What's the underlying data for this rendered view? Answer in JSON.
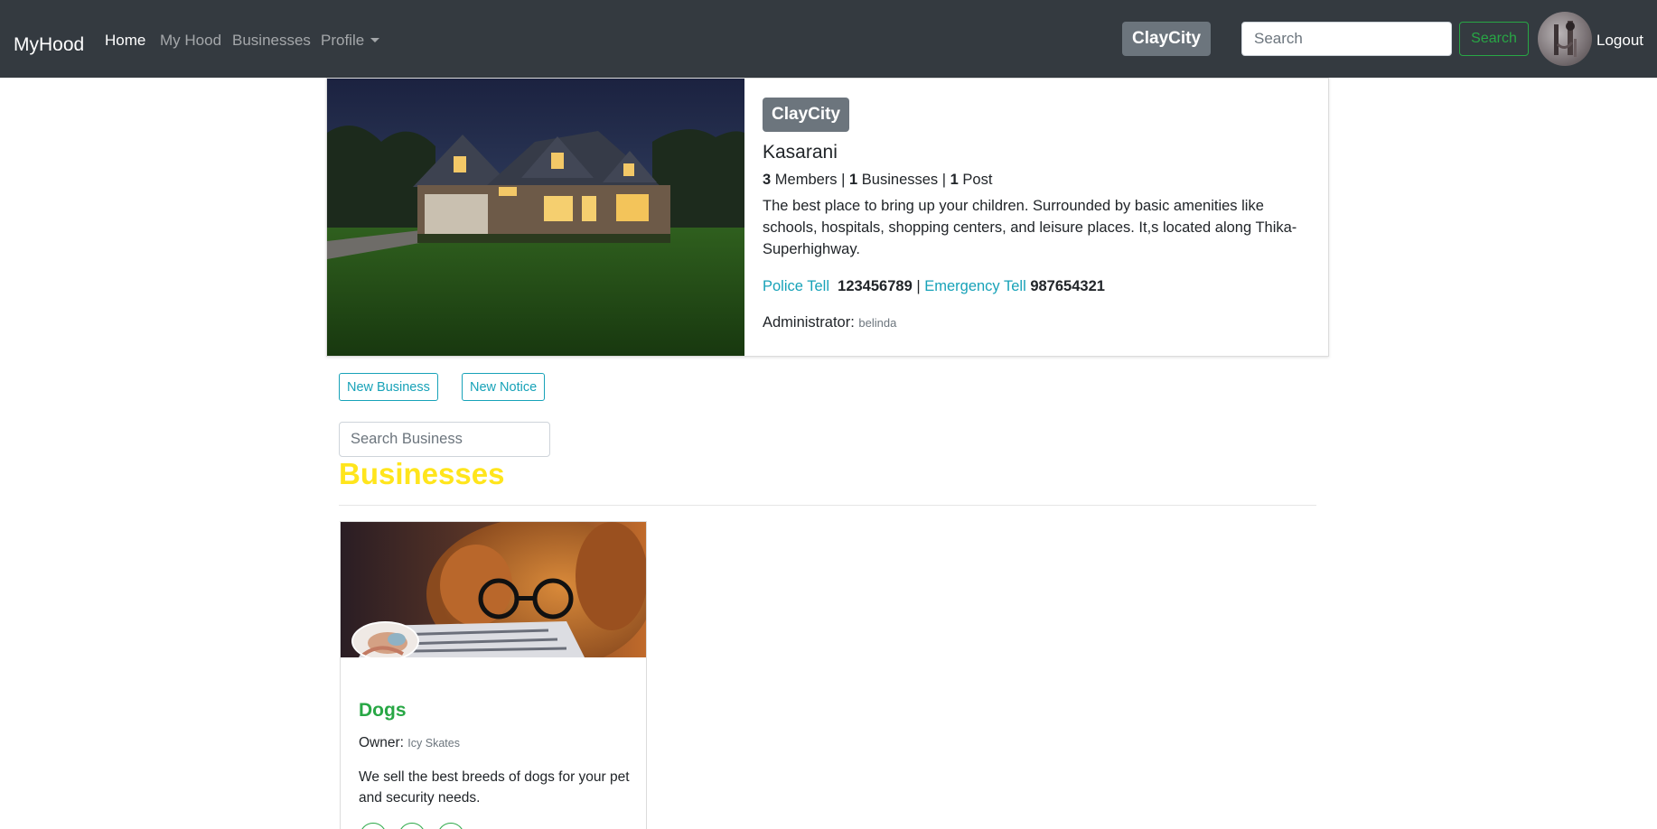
{
  "navbar": {
    "brand": "MyHood",
    "links": [
      {
        "label": "Home",
        "active": true
      },
      {
        "label": "My Hood",
        "active": false
      },
      {
        "label": "Businesses",
        "active": false
      },
      {
        "label": "Profile",
        "active": false
      }
    ],
    "hood_badge": "ClayCity",
    "search_placeholder": "Search",
    "search_button": "Search",
    "logout": "Logout"
  },
  "hood": {
    "name": "ClayCity",
    "location": "Kasarani",
    "members_count": "3",
    "members_label": "Members |",
    "businesses_count": "1",
    "businesses_label": "Businesses |",
    "posts_count": "1",
    "posts_label": "Post",
    "description": "The best place to bring up your children. Surrounded by basic amenities like schools, hospitals, shopping centers, and leisure places. It,s located along Thika-Superhighway.",
    "police_label": "Police Tell",
    "police_number": "123456789",
    "separator": "|",
    "emergency_label": "Emergency Tell",
    "emergency_number": "987654321",
    "admin_label": "Administrator:",
    "admin_name": "belinda"
  },
  "actions": {
    "new_business": "New Business",
    "new_notice": "New Notice",
    "search_placeholder": "Search Business"
  },
  "businesses_section": {
    "title": "Businesses",
    "items": [
      {
        "name": "Dogs",
        "owner_label": "Owner:",
        "owner": "Icy Skates",
        "description": "We sell the best breeds of dogs for your pet and security needs."
      }
    ]
  },
  "colors": {
    "navbar_bg": "#343a40",
    "badge_bg": "#6c757d",
    "info": "#17a2b8",
    "success": "#28a745",
    "section_title": "#ffe51c"
  }
}
